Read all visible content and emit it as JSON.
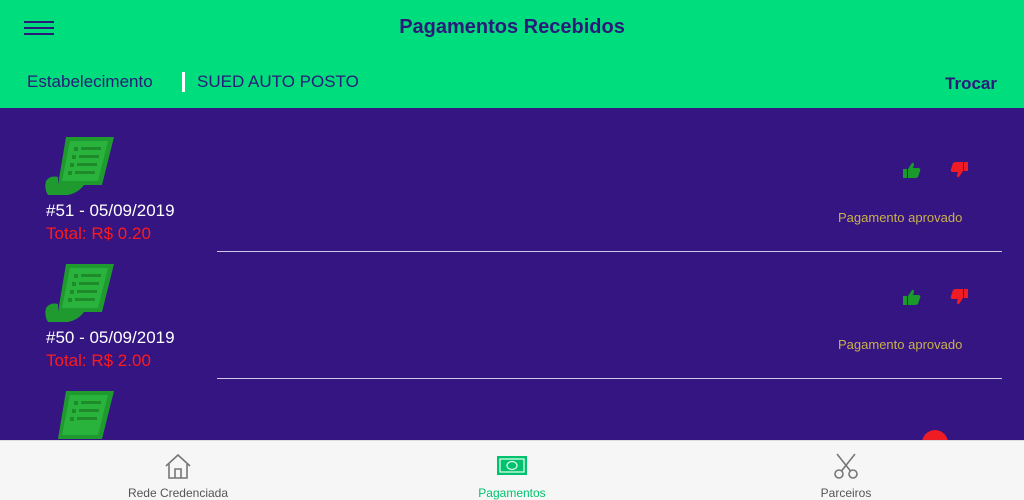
{
  "header": {
    "title": "Pagamentos Recebidos",
    "menu_icon": "hamburger-menu-icon"
  },
  "establishment": {
    "label": "Estabelecimento",
    "name": "SUED AUTO POSTO",
    "change_label": "Trocar"
  },
  "payments": [
    {
      "id_date": "#51 - 05/09/2019",
      "total": "Total: R$ 0.20",
      "status": "Pagamento aprovado"
    },
    {
      "id_date": "#50 - 05/09/2019",
      "total": "Total: R$ 2.00",
      "status": "Pagamento aprovado"
    }
  ],
  "tabs": [
    {
      "label": "Rede Credenciada",
      "icon": "home-icon",
      "active": false
    },
    {
      "label": "Pagamentos",
      "icon": "money-icon",
      "active": true
    },
    {
      "label": "Parceiros",
      "icon": "scissors-icon",
      "active": false
    }
  ],
  "colors": {
    "header_bg": "#00dd7d",
    "list_bg": "#341582",
    "title_text": "#2a1a7a",
    "total_text": "#ff1a1a",
    "status_text": "#c9b14a",
    "approve_icon": "#1a9a2a",
    "reject_icon": "#ee1c24",
    "active_tab": "#00c26e"
  }
}
